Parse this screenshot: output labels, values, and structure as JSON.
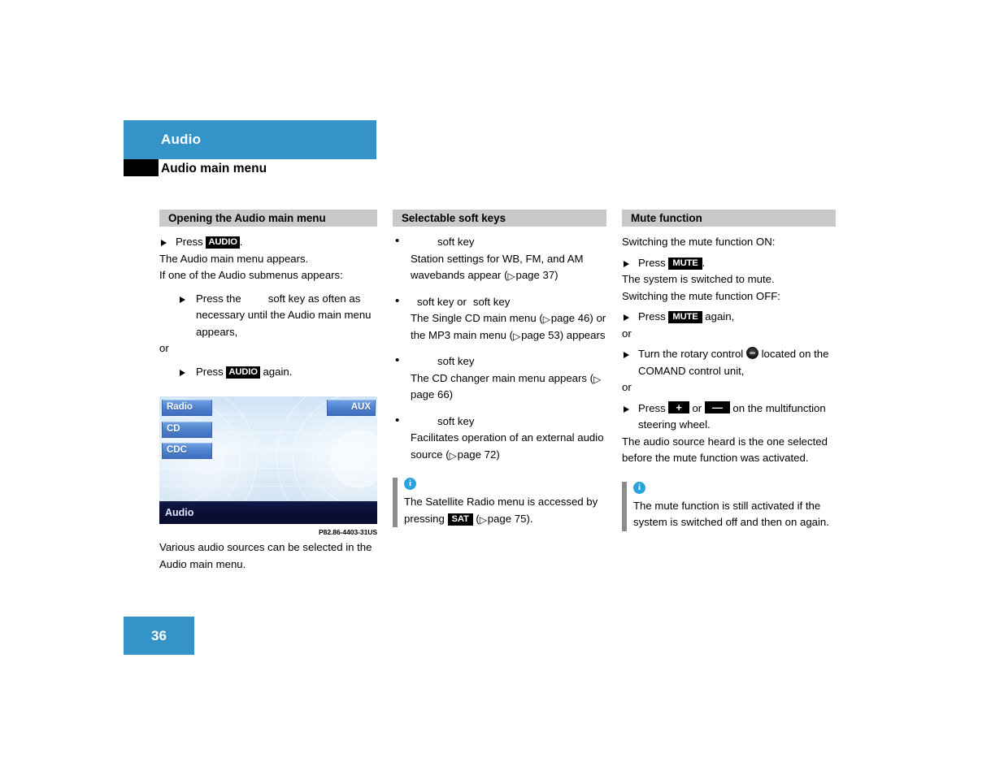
{
  "header": {
    "chapter": "Audio",
    "section": "Audio main menu"
  },
  "page_number": "36",
  "columns": {
    "col1": {
      "heading": "Opening the Audio main menu",
      "step1_press": "Press",
      "step1_key": "AUDIO",
      "step1_end": ".",
      "text1": "The Audio main menu appears.",
      "text2": "If one of the Audio submenus appears:",
      "substep_a": "Press the",
      "substep_a_rest": "soft key as often as necessary until the Audio main menu appears,",
      "or": "or",
      "substep_b_press": "Press",
      "substep_b_key": "AUDIO",
      "substep_b_rest": "again."
    },
    "col2": {
      "heading": "Selectable soft keys",
      "bullets": [
        {
          "key_label": "soft key",
          "desc_pre": "Station settings for WB, FM, and AM wavebands appear (",
          "ref": "page 37",
          "desc_post": ")"
        },
        {
          "key_label": "soft key or",
          "key_label2": "soft key",
          "desc_pre": "The Single CD main menu (",
          "ref": "page 46",
          "desc_mid": ") or the MP3 main menu (",
          "ref2": "page 53",
          "desc_post": ") appears"
        },
        {
          "key_label": "soft key",
          "desc_pre": "The CD changer main menu appears (",
          "ref": "page 66",
          "desc_post": ")"
        },
        {
          "key_label": "soft key",
          "desc_pre": "Facilitates operation of an external audio source (",
          "ref": "page 72",
          "desc_post": ")"
        }
      ],
      "note": {
        "icon": "info-icon",
        "text_pre": "The Satellite Radio menu is accessed by pressing",
        "key": "SAT",
        "text_mid": "(",
        "ref": "page 75",
        "text_post": ")."
      }
    },
    "col3": {
      "heading": "Mute function",
      "text_on": "Switching the mute function ON:",
      "step_on_press": "Press",
      "step_on_key": "MUTE",
      "step_on_end": ".",
      "text_on_result": "The system is switched to mute.",
      "text_off": "Switching the mute function OFF:",
      "step_off_press": "Press",
      "step_off_key": "MUTE",
      "step_off_rest": "again,",
      "or1": "or",
      "step_rotary_pre": "Turn the rotary control",
      "step_rotary_icon": "rotary-control-icon",
      "step_rotary_post": "located on the COMAND control unit,",
      "or2": "or",
      "step_mfsw_press": "Press",
      "step_mfsw_key_plus": "+",
      "step_mfsw_or": "or",
      "step_mfsw_key_minus": "—",
      "step_mfsw_rest": "on the multifunction steering wheel.",
      "text_result": "The audio source heard is the one selected before the mute function was activated.",
      "note": {
        "icon": "info-icon",
        "text": "The mute function is still activated if the system is switched off and then on again."
      }
    }
  },
  "figure": {
    "code": "P82.86-4403-31US",
    "caption": "Various audio sources can be selected in the Audio main menu.",
    "screen": {
      "softkeys_left": [
        "Radio",
        "CD",
        "CDC"
      ],
      "softkey_right": "AUX",
      "status_bar": "Audio"
    }
  },
  "colors": {
    "chapter_blue": "#3494c8",
    "heading_gray": "#c9c9c9",
    "note_bar_gray": "#8c8c8c",
    "info_blue": "#28a3de",
    "keycap_black": "#000000",
    "screen_bottom_navy": "#0b1038"
  }
}
